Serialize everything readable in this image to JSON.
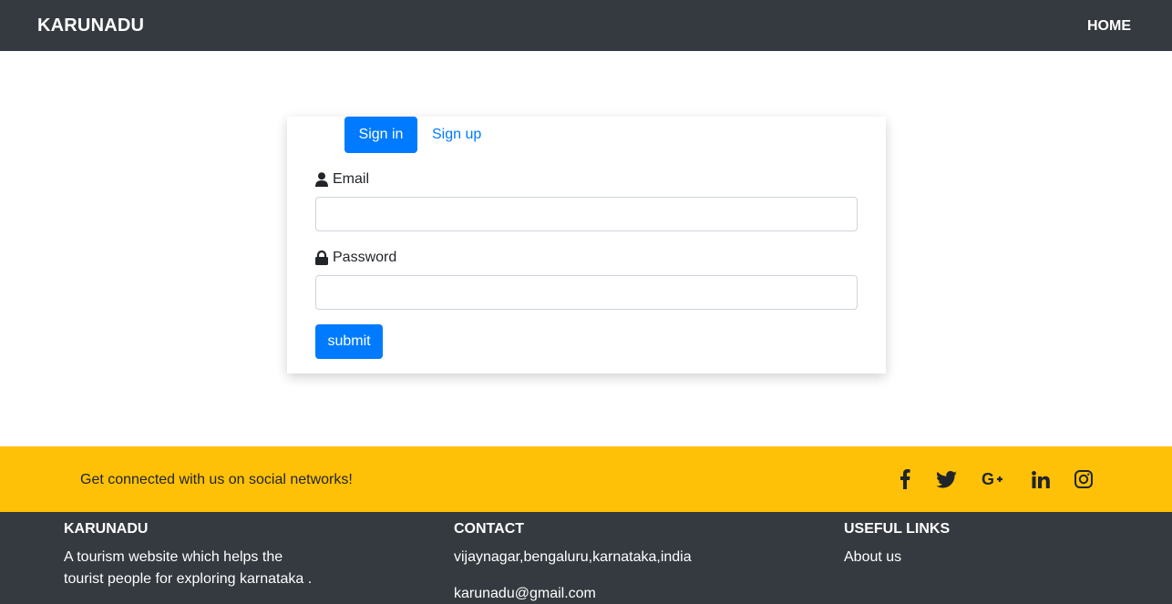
{
  "navbar": {
    "brand": "KARUNADU",
    "home": "HOME"
  },
  "auth": {
    "tabs": {
      "signin": "Sign in",
      "signup": "Sign up"
    },
    "email_label": "Email",
    "password_label": "Password",
    "email_value": "",
    "password_value": "",
    "submit_label": "submit"
  },
  "social": {
    "text": "Get connected with us on social networks!",
    "icons": [
      "facebook-icon",
      "twitter-icon",
      "google-plus-icon",
      "linkedin-icon",
      "instagram-icon"
    ]
  },
  "footer": {
    "about": {
      "heading": "KARUNADU",
      "text_line1": "A tourism website which helps the",
      "text_line2": "tourist people for exploring karnataka ."
    },
    "contact": {
      "heading": "CONTACT",
      "address": "vijaynagar,bengaluru,karnataka,india",
      "email": "karunadu@gmail.com"
    },
    "links": {
      "heading": "USEFUL LINKS",
      "about_us": "About us"
    }
  },
  "colors": {
    "navbar": "#343a40",
    "primary": "#007bff",
    "social_bar": "#ffc107",
    "footer": "#343a40"
  }
}
